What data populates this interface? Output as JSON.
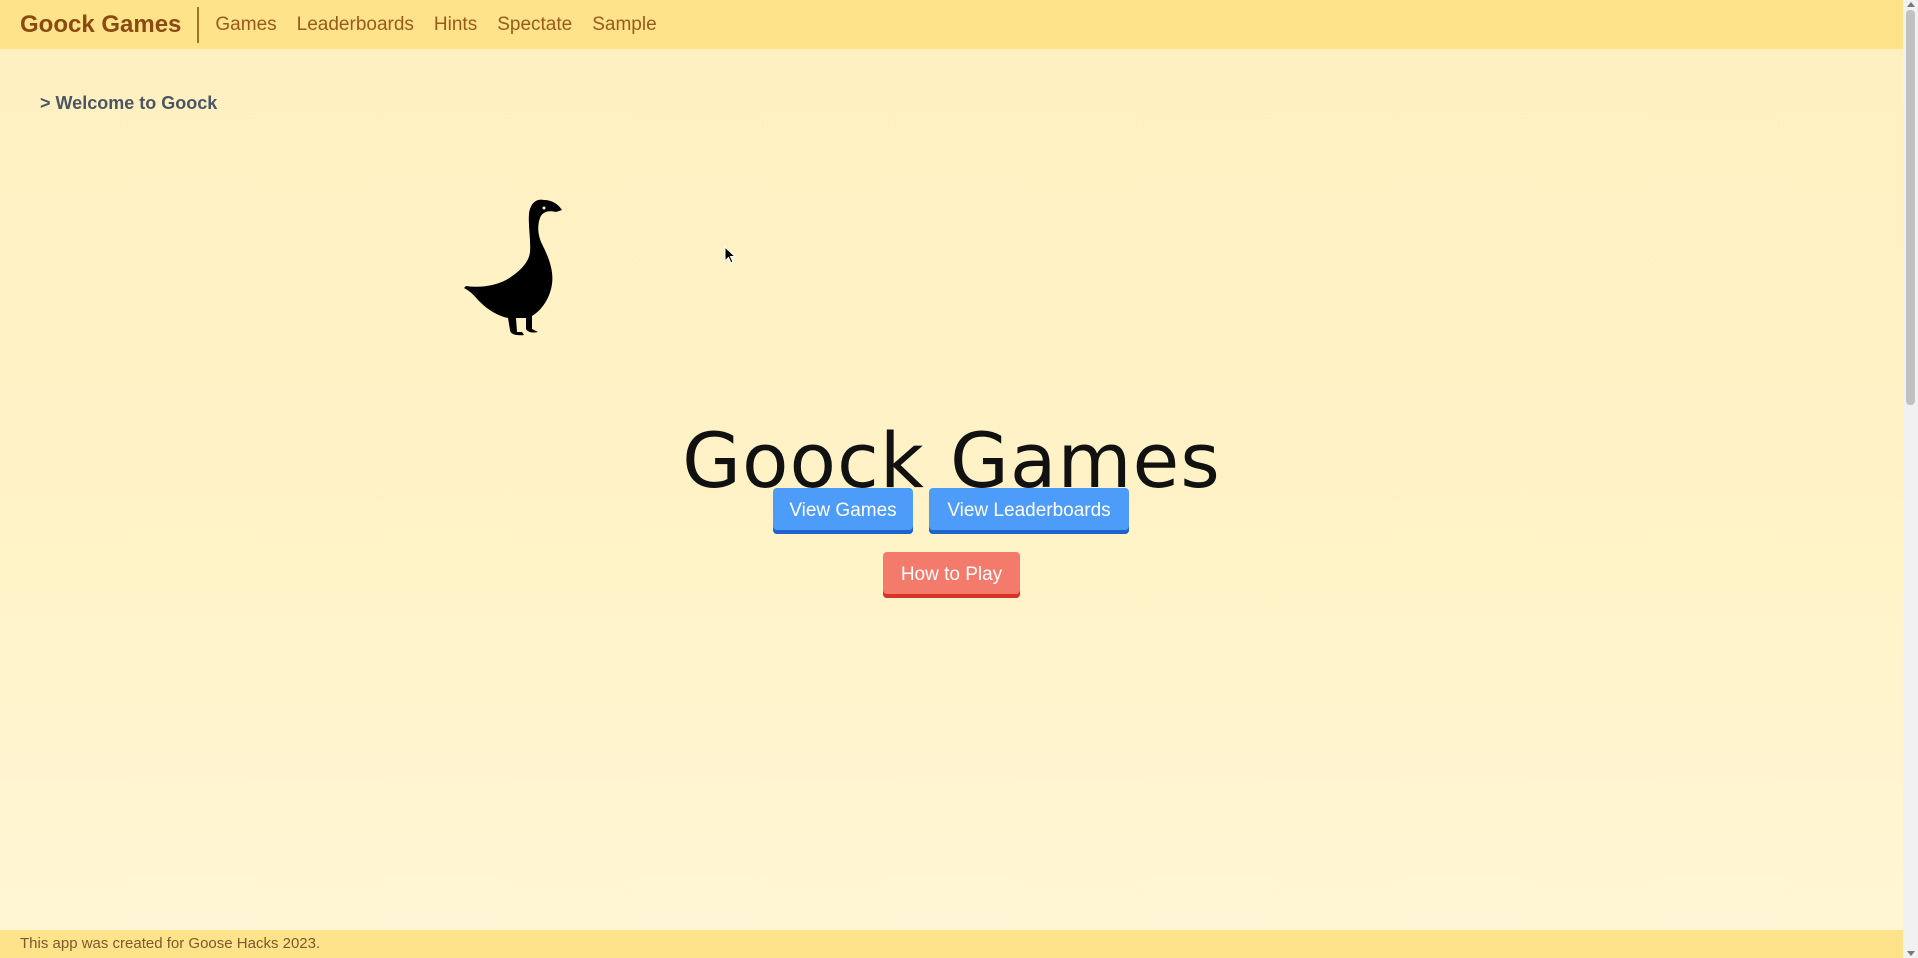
{
  "navbar": {
    "brand": "Goock Games",
    "links": [
      "Games",
      "Leaderboards",
      "Hints",
      "Spectate",
      "Sample"
    ]
  },
  "breadcrumb": "> Welcome to Goock",
  "hero": {
    "logo_icon": "goose-silhouette-icon",
    "title": "Goock Games"
  },
  "buttons": {
    "view_games": "View Games",
    "view_leaderboards": "View Leaderboards",
    "how_to_play": "How to Play"
  },
  "footer": {
    "text": "This app was created for Goose Hacks 2023."
  },
  "colors": {
    "navbar_bg": "#ffe38a",
    "page_bg": "#fff3c6",
    "brand": "#8a4a12",
    "primary_button": "#4d9cf9",
    "danger_button": "#f47a6c"
  }
}
